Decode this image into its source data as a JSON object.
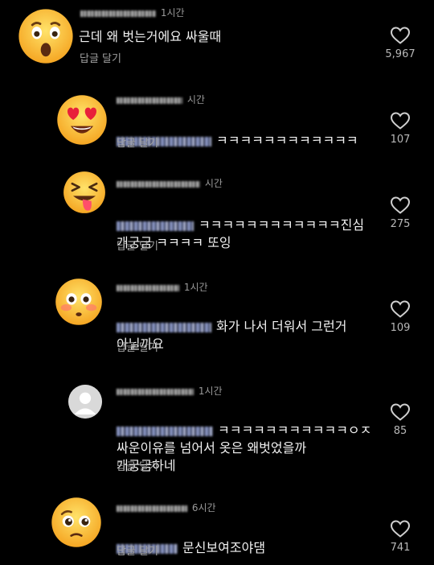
{
  "reply_label": "답글 달기",
  "comments": [
    {
      "id": "c0",
      "time": "1시간",
      "text": "근데 왜 벗는거에요 싸울때",
      "likes": "5,967",
      "avatar": "astonished-face-emoji"
    },
    {
      "id": "c1",
      "time": "시간",
      "text": "ㅋㅋㅋㅋㅋㅋㅋㅋㅋㅋㅋㅋ",
      "likes": "107",
      "avatar": "heart-eyes-emoji"
    },
    {
      "id": "c2",
      "time": "시간",
      "text": "ㅋㅋㅋㅋㅋㅋㅋㅋㅋㅋㅋㅋ진심\n개궁금 ㅋㅋㅋㅋ 또잉",
      "likes": "275",
      "avatar": "zany-face-emoji"
    },
    {
      "id": "c3",
      "time": "1시간",
      "text": "화가 나서 더워서 그런거\n아닐까요",
      "likes": "109",
      "avatar": "flushed-face-emoji"
    },
    {
      "id": "c4",
      "time": "1시간",
      "text": "ㅋㅋㅋㅋㅋㅋㅋㅋㅋㅋㅋㅇㅈ\n싸운이유를 넘어서 옷은 왜벗었을까\n개궁금하네",
      "likes": "85",
      "avatar": "default-avatar"
    },
    {
      "id": "c5",
      "time": "6시간",
      "text": "문신보여조야댐",
      "likes": "741",
      "avatar": "pleading-face-emoji"
    }
  ],
  "colors": {
    "background": "#000000",
    "meta": "#9a9a9a",
    "like": "#b8b8b8"
  }
}
